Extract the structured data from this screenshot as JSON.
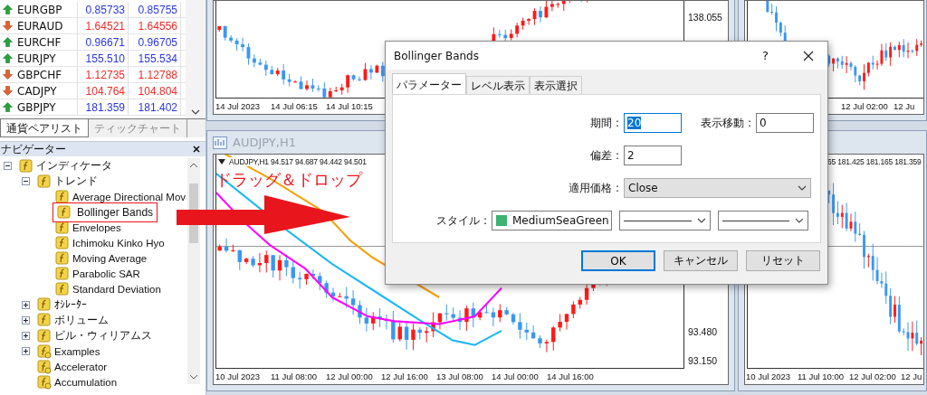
{
  "market_watch": {
    "rows": [
      {
        "symbol": "EURGBP",
        "kind": "up",
        "bid": "0.85733",
        "ask": "0.85755"
      },
      {
        "symbol": "EURAUD",
        "kind": "down",
        "bid": "1.64521",
        "ask": "1.64556"
      },
      {
        "symbol": "EURCHF",
        "kind": "up",
        "bid": "0.96671",
        "ask": "0.96705"
      },
      {
        "symbol": "EURJPY",
        "kind": "up",
        "bid": "155.510",
        "ask": "155.534"
      },
      {
        "symbol": "GBPCHF",
        "kind": "down",
        "bid": "1.12735",
        "ask": "1.12788"
      },
      {
        "symbol": "CADJPY",
        "kind": "down",
        "bid": "104.764",
        "ask": "104.804"
      },
      {
        "symbol": "GBPJPY",
        "kind": "up",
        "bid": "181.359",
        "ask": "181.402"
      }
    ],
    "tabs": [
      {
        "label": "通貨ペアリスト",
        "selected": true
      },
      {
        "label": "ティックチャート",
        "selected": false
      }
    ]
  },
  "navigator": {
    "title": "ナビゲーター",
    "tree": [
      {
        "label": "インディケータ",
        "kind": "builtin",
        "expanded": true,
        "selected": false,
        "children": [
          {
            "label": "トレンド",
            "kind": "builtin",
            "expanded": true,
            "selected": false,
            "children": [
              {
                "label": "Average Directional Mov",
                "kind": "builtin",
                "selected": false
              },
              {
                "label": "Bollinger Bands",
                "kind": "builtin",
                "selected": true
              },
              {
                "label": "Envelopes",
                "kind": "builtin",
                "selected": false
              },
              {
                "label": "Ichimoku Kinko Hyo",
                "kind": "builtin",
                "selected": false
              },
              {
                "label": "Moving Average",
                "kind": "builtin",
                "selected": false
              },
              {
                "label": "Parabolic SAR",
                "kind": "builtin",
                "selected": false
              },
              {
                "label": "Standard Deviation",
                "kind": "builtin",
                "selected": false
              }
            ]
          },
          {
            "label": "ｵｼﾚｰﾀｰ",
            "kind": "builtin",
            "expanded": false,
            "selected": false
          },
          {
            "label": "ボリューム",
            "kind": "builtin",
            "expanded": false,
            "selected": false
          },
          {
            "label": "ビル・ウィリアムス",
            "kind": "builtin",
            "expanded": false,
            "selected": false
          },
          {
            "label": "Examples",
            "kind": "custom",
            "expanded": false,
            "selected": false
          },
          {
            "label": "Accelerator",
            "kind": "custom",
            "selected": false
          },
          {
            "label": "Accumulation",
            "kind": "custom",
            "selected": false
          }
        ]
      }
    ]
  },
  "annotation": "ドラッグ＆ドロップ",
  "charts": [
    {
      "x_labels": [
        "14 Jul 2023",
        "14 Jul 06:15",
        "14 Jul 10:15"
      ],
      "price_labels": [
        "138.055"
      ]
    },
    {
      "x_labels": [
        "12 Jul 02:00",
        "12 Ju"
      ]
    },
    {
      "title": "AUDJPY,H1",
      "header_menu": true,
      "header": "AUDJPY,H1  94.517 94.687 94.442 94.501",
      "x_labels": [
        "10 Jul 2023",
        "11 Jul 08:00",
        "12 Jul 00:00",
        "12 Jul 16:00",
        "13 Jul 08:00",
        "14 Jul 00:00",
        "14 Jul 16:00"
      ],
      "price_labels": [
        "93.480",
        "93.150"
      ]
    },
    {
      "header": "65 181.425 181.165 181.359",
      "x_labels": [
        "10 Jul 2023",
        "11 Jul 10:00",
        "12 Jul 02:00",
        "12 Ju"
      ]
    }
  ],
  "dialog": {
    "title": "Bollinger Bands",
    "help": "?",
    "tabs": [
      {
        "label": "パラメーター",
        "selected": true
      },
      {
        "label": "レベル表示",
        "selected": false
      },
      {
        "label": "表示選択",
        "selected": false
      }
    ],
    "fields": [
      {
        "label": "期間 :",
        "value": "20",
        "focused": true
      },
      {
        "label": "表示移動 :",
        "value": "0",
        "focused": false
      },
      {
        "label": "偏差 :",
        "value": "2",
        "focused": false
      }
    ],
    "applied_price": {
      "label": "適用価格 :",
      "value": "Close"
    },
    "style": {
      "label": "スタイル :",
      "color_name": "MediumSeaGreen",
      "color": "#3cb371"
    },
    "buttons": [
      {
        "label": "OK",
        "default": true
      },
      {
        "label": "キャンセル",
        "default": false
      },
      {
        "label": "リセット",
        "default": false
      }
    ]
  }
}
